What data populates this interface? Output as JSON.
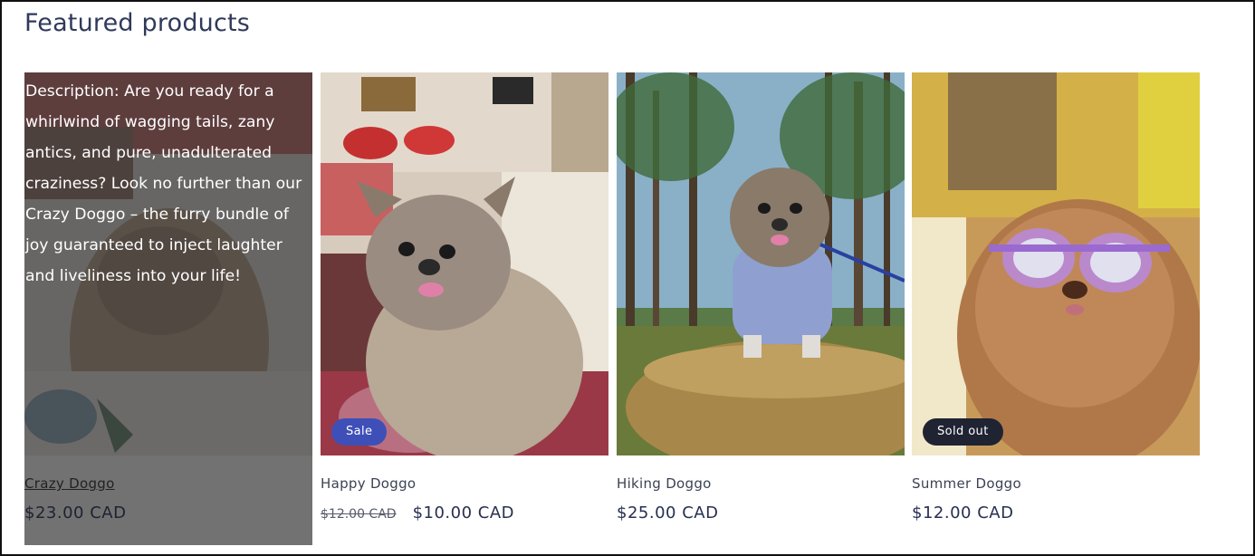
{
  "section": {
    "title": "Featured products"
  },
  "products": [
    {
      "name": "Crazy Doggo",
      "price": "$23.00 CAD",
      "description": "Description: Are you ready for a whirlwind of wagging tails, zany antics, and pure, unadulterated craziness? Look no further than our Crazy Doggo – the furry bundle of joy guaranteed to inject laughter and liveliness into your life!"
    },
    {
      "name": "Happy Doggo",
      "price_regular": "$12.00 CAD",
      "price": "$10.00 CAD",
      "badge": "Sale"
    },
    {
      "name": "Hiking Doggo",
      "price": "$25.00 CAD"
    },
    {
      "name": "Summer Doggo",
      "price": "$12.00 CAD",
      "badge": "Sold out"
    }
  ],
  "colors": {
    "title": "#2f3a5a",
    "sale_badge": "#3e4fb8",
    "soldout_badge": "#1f2332",
    "price": "#263050"
  }
}
